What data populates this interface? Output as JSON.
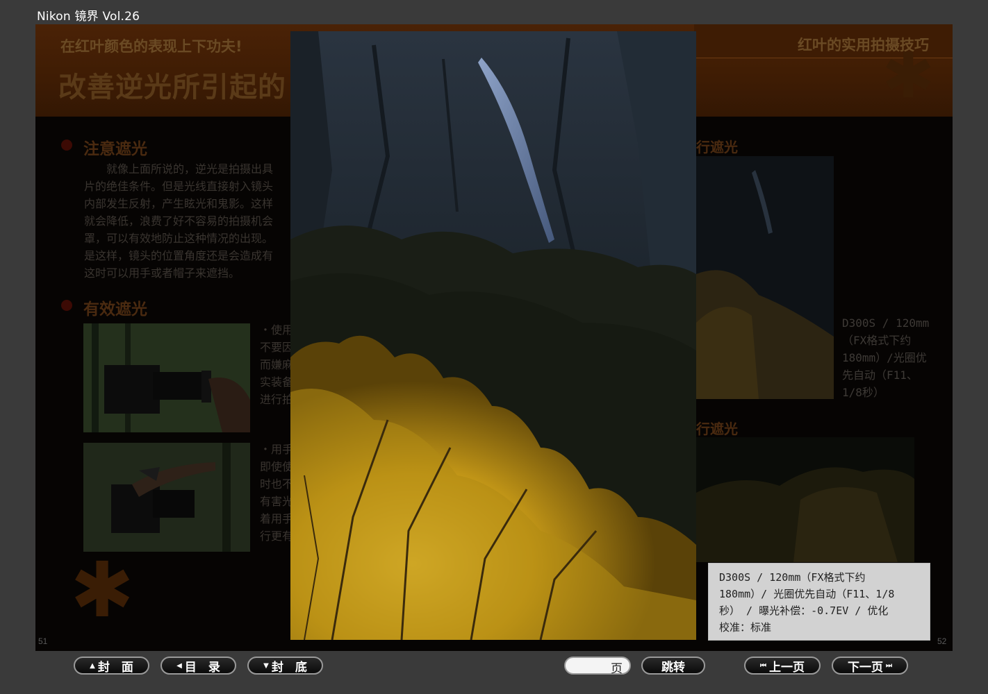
{
  "app": {
    "title": "Nikon 镜界 Vol.26"
  },
  "spread": {
    "kicker_left": "在红叶颜色的表现上下功夫!",
    "kicker_right": "红叶的实用拍摄技巧",
    "headline": "改善逆光所引起的",
    "section1_title": "注意遮光",
    "section1_lines": [
      "　　就像上面所说的，逆光是拍摄出具",
      "片的绝佳条件。但是光线直接射入镜头",
      "内部发生反射，产生眩光和鬼影。这样",
      "就会降低，浪费了好不容易的拍摄机会",
      "罩，可以有效地防止这种情况的出现。",
      "是这样，镜头的位置角度还是会造成有",
      "这时可以用手或者帽子来遮挡。"
    ],
    "section2_title": "有效遮光",
    "tip1_lines": [
      "・使用",
      "不要因",
      "而嫌麻",
      "实装备",
      "进行拍"
    ],
    "tip2_lines": [
      "・用手",
      "即使使",
      "时也不",
      "有害光",
      "着用手",
      "行更有"
    ],
    "right_heading1": "行遮光",
    "right_heading2": "行遮光",
    "right_caption_lines": [
      "D300S / 120mm",
      "（FX格式下约",
      "180mm）/光圈优",
      "先自动（F11、",
      "1/8秒）"
    ],
    "page_left": "51",
    "page_right": "52"
  },
  "popup": {
    "caption_lines": [
      "D300S / 120mm（FX格式下约",
      "180mm）/ 光圈优先自动（F11、1/8",
      "秒） / 曝光补偿：-0.7EV / 优化",
      "校准：标准"
    ]
  },
  "nav": {
    "cover": "封　面",
    "toc": "目　录",
    "back_cover": "封　底",
    "page_value": "",
    "page_suffix": "页",
    "jump": "跳转",
    "prev": "上一页",
    "next": "下一页"
  },
  "icons": {
    "cover": "triangle-up-icon",
    "toc": "triangle-left-icon",
    "back_cover": "triangle-down-icon",
    "prev": "skip-back-icon",
    "next": "skip-forward-icon"
  },
  "colors": {
    "background": "#3a3a3a",
    "banner": "#3e1c04",
    "info_box": "#d2d2d2"
  }
}
